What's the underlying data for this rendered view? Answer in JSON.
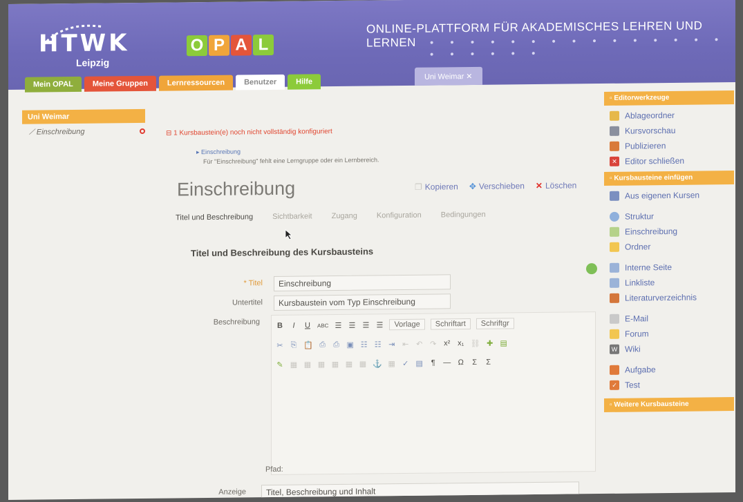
{
  "header": {
    "logo_text": "HTWK",
    "logo_city": "Leipzig",
    "opal_letters": [
      "O",
      "P",
      "A",
      "L"
    ],
    "platform_title": "ONLINE-PLATTFORM FÜR AKADEMISCHES LEHREN UND LERNEN",
    "tabs": [
      {
        "label": "Mein OPAL",
        "color": "#8fae3c"
      },
      {
        "label": "Meine Gruppen",
        "color": "#e4553a"
      },
      {
        "label": "Lernressourcen",
        "color": "#f0a53a"
      },
      {
        "label": "Benutzer",
        "color": "#ffffff"
      },
      {
        "label": "Hilfe",
        "color": "#8ccb3a"
      }
    ],
    "course_tab": "Uni Weimar ✕"
  },
  "tree": {
    "root": "Uni Weimar",
    "child": "Einschreibung"
  },
  "warning": {
    "main": "1 Kursbaustein(e) noch nicht vollständig konfiguriert",
    "sub_link": "▸ Einschreibung",
    "sub_text": "Für \"Einschreibung\" fehlt eine Lerngruppe oder ein Lernbereich."
  },
  "page": {
    "title": "Einschreibung",
    "actions": {
      "copy": "Kopieren",
      "move": "Verschieben",
      "delete": "Löschen"
    },
    "subtabs": [
      "Titel und Beschreibung",
      "Sichtbarkeit",
      "Zugang",
      "Konfiguration",
      "Bedingungen"
    ],
    "section_title": "Titel und Beschreibung des Kursbausteins"
  },
  "form": {
    "title_label": "* Titel",
    "title_value": "Einschreibung",
    "subtitle_label": "Untertitel",
    "subtitle_value": "Kursbaustein vom Typ Einschreibung",
    "desc_label": "Beschreibung",
    "toolbar": {
      "row1": [
        "B",
        "I",
        "U",
        "ABC"
      ],
      "format_select": "Vorlage",
      "font_select": "Schriftart",
      "size_select": "Schriftgr",
      "row2": [
        "x²",
        "x₁"
      ],
      "row3": [
        "¶",
        "—",
        "Ω",
        "Σ",
        "Σ"
      ]
    },
    "path_label": "Pfad:",
    "display_label": "Anzeige",
    "display_value": "Titel, Beschreibung und Inhalt"
  },
  "right_panel": {
    "tools_head": "Editorwerkzeuge",
    "tools": [
      {
        "label": "Ablageordner",
        "icon": "folder-icon",
        "color": "#e6b84a"
      },
      {
        "label": "Kursvorschau",
        "icon": "monitor-icon",
        "color": "#8a8f9e"
      },
      {
        "label": "Publizieren",
        "icon": "publish-icon",
        "color": "#d97a3a"
      },
      {
        "label": "Editor schließen",
        "icon": "close-icon",
        "color": "#d9443a"
      }
    ],
    "insert_head": "Kursbausteine einfügen",
    "insert": [
      {
        "label": "Aus eigenen Kursen",
        "icon": "import-icon",
        "color": "#7b8fc0"
      },
      {
        "label": "Struktur",
        "icon": "structure-icon",
        "color": "#8fb0dc"
      },
      {
        "label": "Einschreibung",
        "icon": "enroll-icon",
        "color": "#b5d28a"
      },
      {
        "label": "Ordner",
        "icon": "folder-icon",
        "color": "#f2c650"
      },
      {
        "label": "Interne Seite",
        "icon": "page-icon",
        "color": "#9bb3d8"
      },
      {
        "label": "Linkliste",
        "icon": "link-icon",
        "color": "#9bb3d8"
      },
      {
        "label": "Literaturverzeichnis",
        "icon": "book-icon",
        "color": "#d4763a"
      },
      {
        "label": "E-Mail",
        "icon": "mail-icon",
        "color": "#c9c9c9"
      },
      {
        "label": "Forum",
        "icon": "forum-icon",
        "color": "#f2c650"
      },
      {
        "label": "Wiki",
        "icon": "wiki-icon",
        "color": "#777777"
      },
      {
        "label": "Aufgabe",
        "icon": "task-icon",
        "color": "#e07a3a"
      },
      {
        "label": "Test",
        "icon": "test-icon",
        "color": "#e07a3a"
      }
    ],
    "more_head": "Weitere Kursbausteine"
  }
}
